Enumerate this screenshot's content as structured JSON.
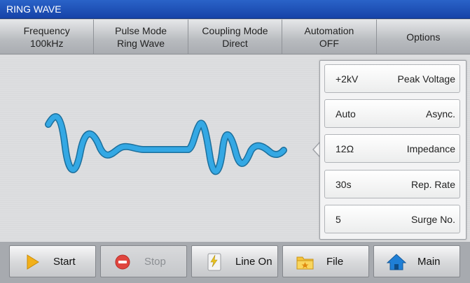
{
  "window": {
    "title": "RING WAVE"
  },
  "tabs": [
    {
      "label": "Frequency",
      "value": "100kHz"
    },
    {
      "label": "Pulse Mode",
      "value": "Ring Wave"
    },
    {
      "label": "Coupling Mode",
      "value": "Direct"
    },
    {
      "label": "Automation",
      "value": "OFF"
    },
    {
      "label": "Options",
      "value": ""
    }
  ],
  "params": [
    {
      "value": "+2kV",
      "label": "Peak Voltage"
    },
    {
      "value": "Auto",
      "label": "Async."
    },
    {
      "value": "12Ω",
      "label": "Impedance"
    },
    {
      "value": "30s",
      "label": "Rep. Rate"
    },
    {
      "value": "5",
      "label": "Surge No."
    }
  ],
  "buttons": {
    "start": "Start",
    "stop": "Stop",
    "line_on": "Line On",
    "file": "File",
    "main": "Main"
  },
  "colors": {
    "titlebar": "#1f55bd",
    "waveform": "#2aa0dc",
    "start_icon": "#f2b01a",
    "stop_icon": "#e0463f",
    "main_icon": "#1f7fd6"
  },
  "icons": {
    "start": "play-icon",
    "stop": "stop-icon",
    "line_on": "lightning-icon",
    "file": "folder-icon",
    "main": "home-icon"
  }
}
